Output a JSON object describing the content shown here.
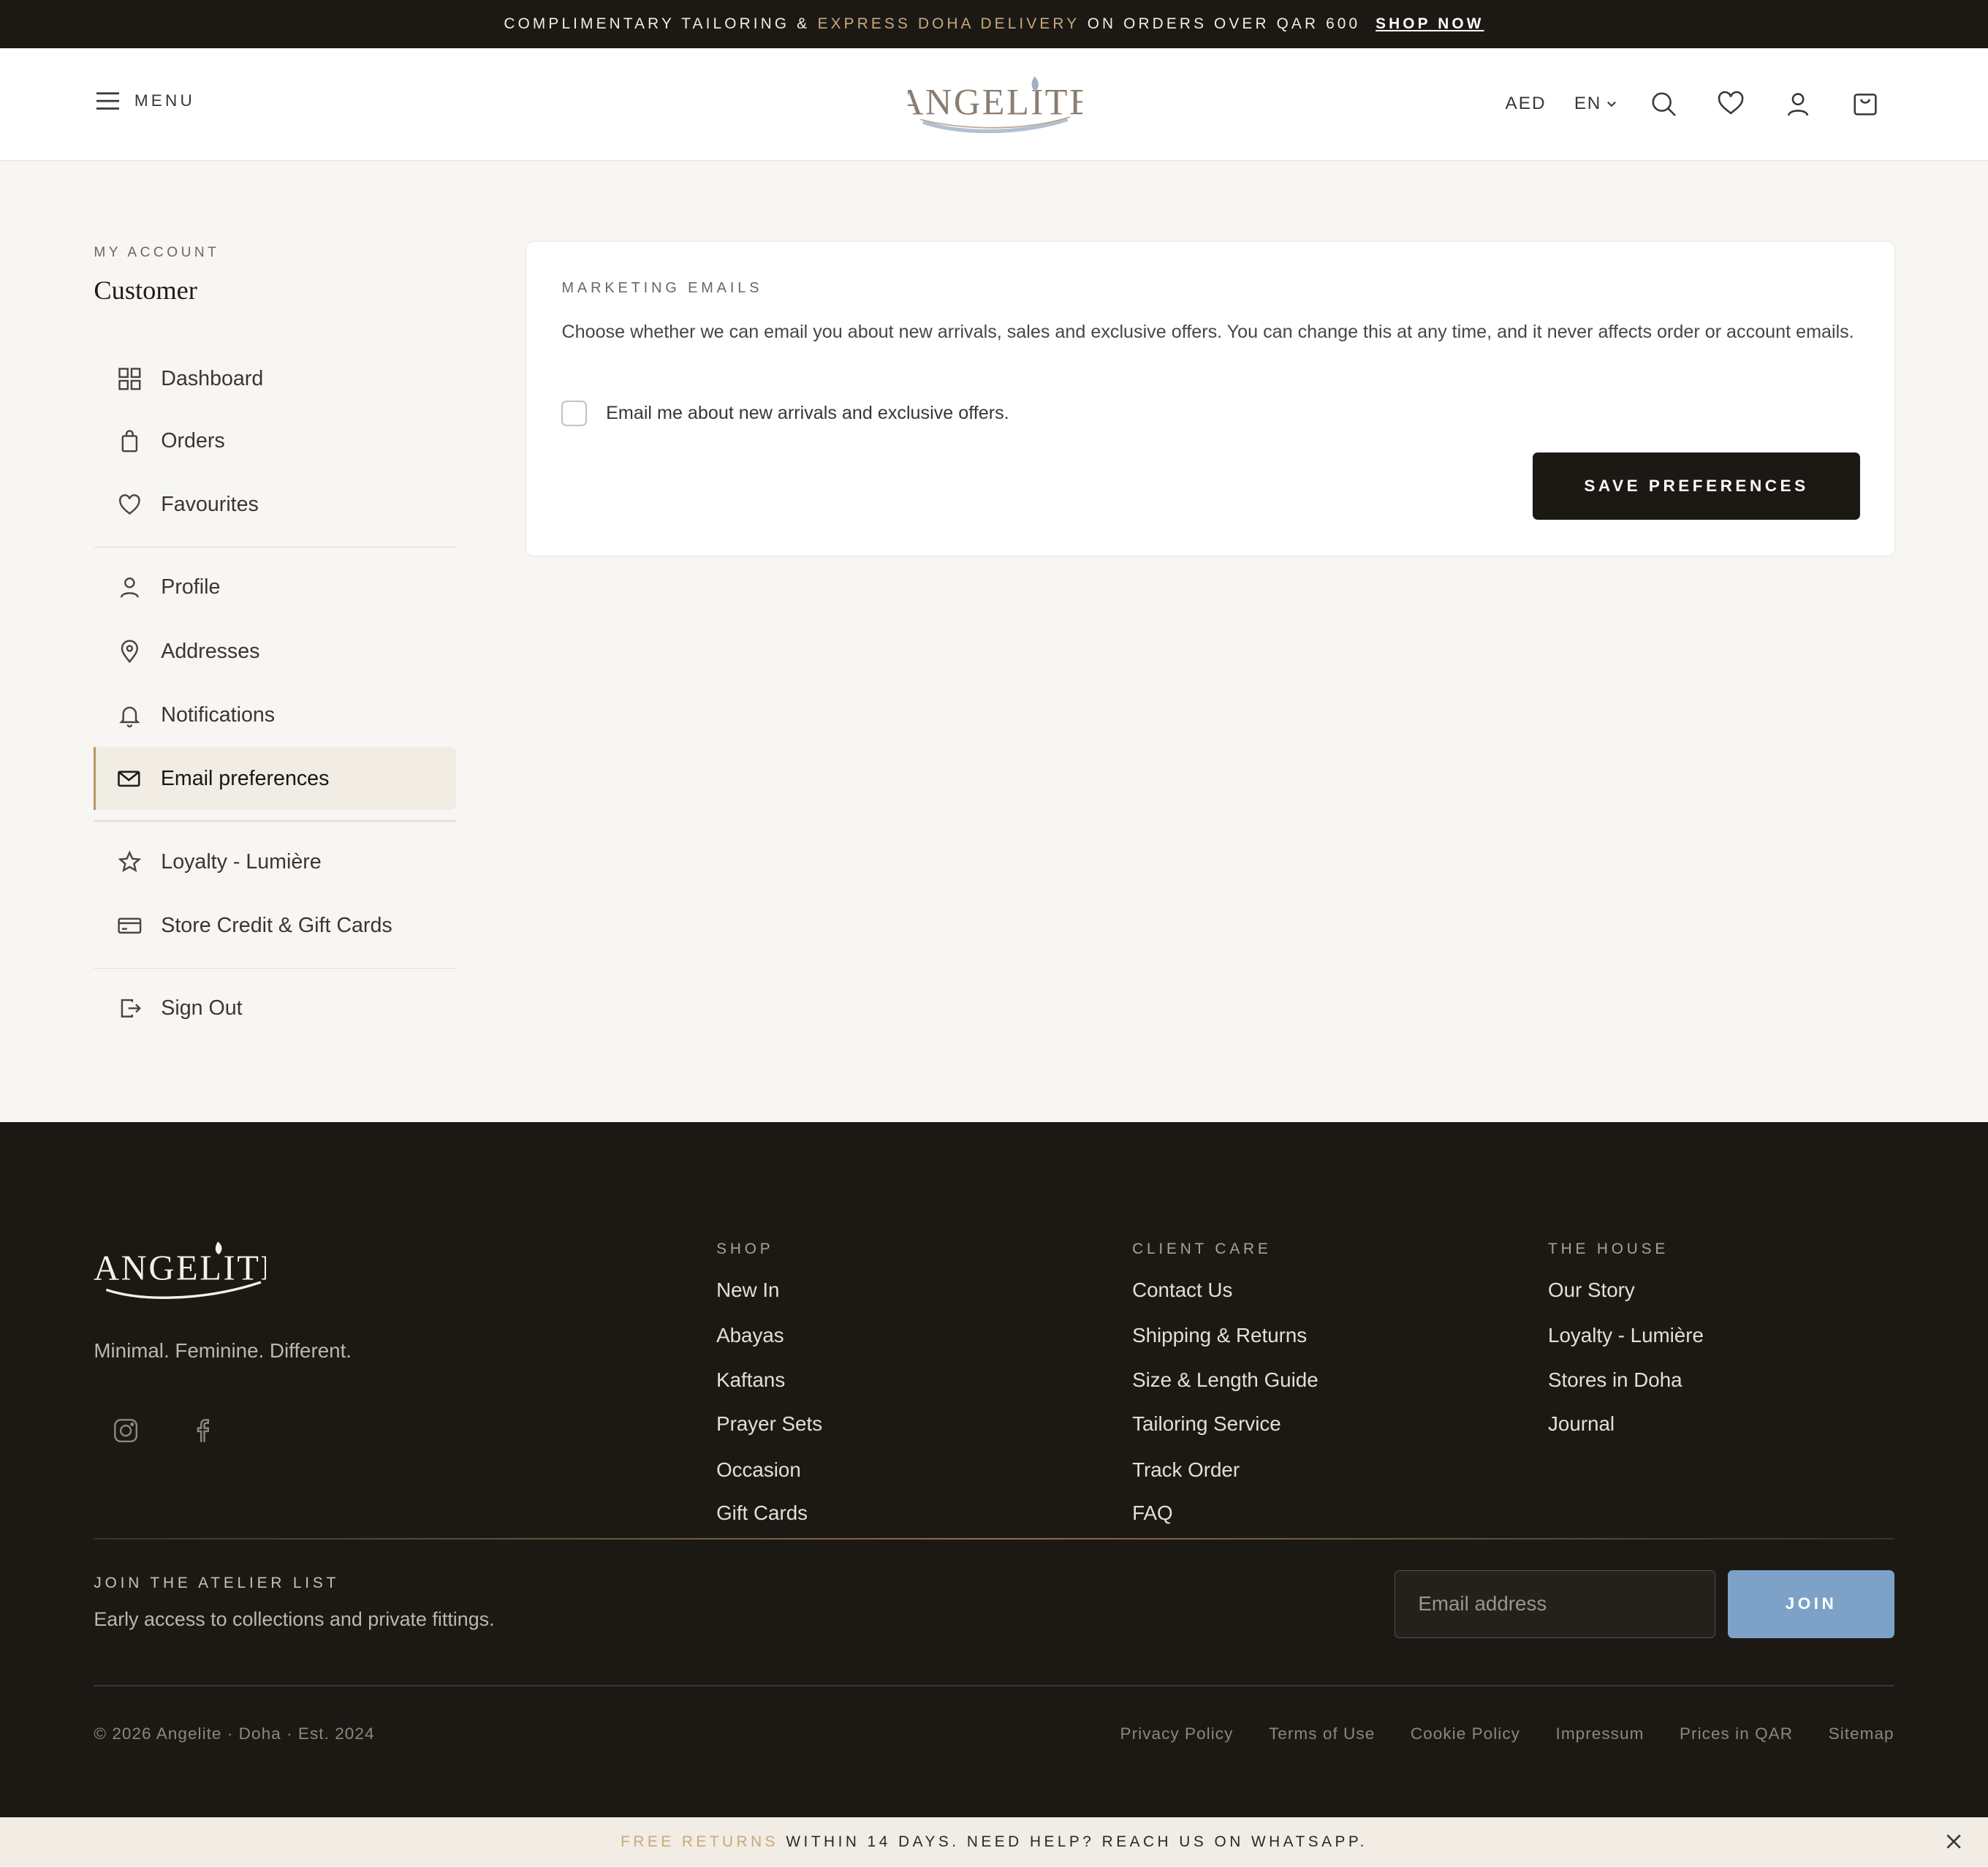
{
  "topbar": {
    "text1": "COMPLIMENTARY TAILORING &",
    "accent": "EXPRESS DOHA DELIVERY",
    "text2": "ON ORDERS OVER QAR 600",
    "cta": "SHOP NOW",
    "accent_color": "#c9a97a"
  },
  "header": {
    "menu_label": "MENU",
    "logo_text": "ANGELITE",
    "currency": "AED",
    "language": "EN",
    "icons": [
      "search-icon",
      "heart-icon",
      "user-icon",
      "bag-icon"
    ]
  },
  "sidebar": {
    "eyebrow": "MY ACCOUNT",
    "name": "Customer",
    "items": [
      {
        "label": "Dashboard",
        "icon": "grid-icon"
      },
      {
        "label": "Orders",
        "icon": "bag-icon"
      },
      {
        "label": "Favourites",
        "icon": "heart-icon"
      },
      {
        "label": "Profile",
        "icon": "user-icon"
      },
      {
        "label": "Addresses",
        "icon": "pin-icon"
      },
      {
        "label": "Notifications",
        "icon": "bell-icon"
      },
      {
        "label": "Email preferences",
        "icon": "mail-icon",
        "active": true
      },
      {
        "label": "Loyalty - Lumière",
        "icon": "star-icon"
      },
      {
        "label": "Store Credit & Gift Cards",
        "icon": "card-icon"
      },
      {
        "label": "Sign Out",
        "icon": "sign-out-icon"
      }
    ]
  },
  "card": {
    "eyebrow": "MARKETING EMAILS",
    "description": "Choose whether we can email you about new arrivals, sales and exclusive offers. You can change this at any time, and it never affects order or account emails.",
    "checkbox_label": "Email me about new arrivals and exclusive offers.",
    "checkbox_checked": false,
    "save_label": "SAVE PREFERENCES"
  },
  "footer": {
    "logo_text": "ANGELITE",
    "tagline": "Minimal. Feminine. Different.",
    "social": [
      "instagram-icon",
      "facebook-icon"
    ],
    "columns": [
      {
        "title": "SHOP",
        "links": [
          "New In",
          "Abayas",
          "Kaftans",
          "Prayer Sets",
          "Occasion",
          "Gift Cards"
        ]
      },
      {
        "title": "CLIENT CARE",
        "links": [
          "Contact Us",
          "Shipping & Returns",
          "Size & Length Guide",
          "Tailoring Service",
          "Track Order",
          "FAQ"
        ]
      },
      {
        "title": "THE HOUSE",
        "links": [
          "Our Story",
          "Loyalty - Lumière",
          "Stores in Doha",
          "Journal"
        ]
      }
    ],
    "join_eyebrow": "JOIN THE ATELIER LIST",
    "join_desc": "Early access to collections and private fittings.",
    "email_placeholder": "Email address",
    "join_label": "JOIN",
    "join_color": "#7ea1c8",
    "copyright": "© 2026 Angelite · Doha · Est. 2024",
    "legal": [
      "Privacy Policy",
      "Terms of Use",
      "Cookie Policy",
      "Impressum",
      "Prices in QAR",
      "Sitemap"
    ]
  },
  "bottombar": {
    "accent": "FREE RETURNS",
    "text": "WITHIN 14 DAYS. NEED HELP? REACH US ON WHATSAPP."
  }
}
